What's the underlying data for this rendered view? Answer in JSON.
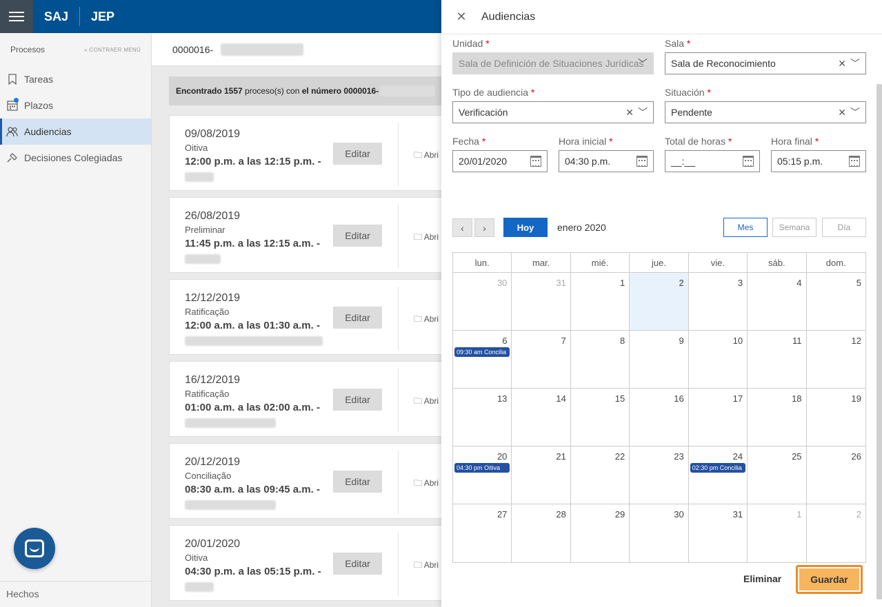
{
  "topbar": {
    "brand1": "SAJ",
    "brand2": "JEP"
  },
  "sidebar": {
    "title": "Procesos",
    "collapse": "CONTRAER MENÚ",
    "items": [
      {
        "label": "Tareas",
        "icon": "bookmark-icon"
      },
      {
        "label": "Plazos",
        "icon": "calendar-icon"
      },
      {
        "label": "Audiencias",
        "icon": "people-icon"
      },
      {
        "label": "Decisiones Colegiadas",
        "icon": "gavel-icon"
      }
    ],
    "footer": "Hechos"
  },
  "main": {
    "search_value": "0000016-",
    "found": {
      "prefix": "Encontrado 1557",
      "middle": " proceso(s) con ",
      "bold": "el número 0000016-"
    },
    "cards": [
      {
        "date": "09/08/2019",
        "type": "Oitiva",
        "time": "12:00 p.m. a las 12:15 p.m. -",
        "edit": "Editar",
        "open": "Abri"
      },
      {
        "date": "26/08/2019",
        "type": "Preliminar",
        "time": "11:45 p.m. a las 12:15 a.m. -",
        "edit": "Editar",
        "open": "Abri"
      },
      {
        "date": "12/12/2019",
        "type": "Ratificação",
        "time": "12:00 a.m. a las 01:30 a.m. -",
        "edit": "Editar",
        "open": "Abri"
      },
      {
        "date": "16/12/2019",
        "type": "Ratificação",
        "time": "01:00 a.m. a las 02:00 a.m. -",
        "edit": "Editar",
        "open": "Abri"
      },
      {
        "date": "20/12/2019",
        "type": "Conciliação",
        "time": "08:30 a.m. a las 09:45 a.m. -",
        "edit": "Editar",
        "open": "Abri"
      },
      {
        "date": "20/01/2020",
        "type": "Oitiva",
        "time": "04:30 p.m. a las 05:15 p.m. -",
        "edit": "Editar",
        "open": "Abri"
      }
    ]
  },
  "panel": {
    "title": "Audiencias",
    "unidad": {
      "label": "Unidad",
      "value": "Sala de Definición de Situaciones Jurídicas"
    },
    "sala": {
      "label": "Sala",
      "value": "Sala de Reconocimiento"
    },
    "tipo": {
      "label": "Tipo de audiencia",
      "value": "Verificación"
    },
    "situacion": {
      "label": "Situación",
      "value": "Pendente"
    },
    "fecha": {
      "label": "Fecha",
      "value": "20/01/2020"
    },
    "hora_inicial": {
      "label": "Hora inicial",
      "value": "04:30 p.m."
    },
    "total_horas": {
      "label": "Total de horas",
      "value": "__:__"
    },
    "hora_final": {
      "label": "Hora final",
      "value": "05:15 p.m."
    },
    "required_mark": "*",
    "calendar": {
      "today_btn": "Hoy",
      "month_label": "enero 2020",
      "views": [
        "Mes",
        "Semana",
        "Día"
      ],
      "weekdays": [
        "lun.",
        "mar.",
        "mié.",
        "jue.",
        "vie.",
        "sáb.",
        "dom."
      ],
      "weeks": [
        [
          {
            "d": "30",
            "o": true
          },
          {
            "d": "31",
            "o": true
          },
          {
            "d": "1"
          },
          {
            "d": "2",
            "t": true
          },
          {
            "d": "3"
          },
          {
            "d": "4"
          },
          {
            "d": "5"
          }
        ],
        [
          {
            "d": "6",
            "e": "09:30 am Concilia"
          },
          {
            "d": "7"
          },
          {
            "d": "8"
          },
          {
            "d": "9"
          },
          {
            "d": "10"
          },
          {
            "d": "11"
          },
          {
            "d": "12"
          }
        ],
        [
          {
            "d": "13"
          },
          {
            "d": "14"
          },
          {
            "d": "15"
          },
          {
            "d": "16"
          },
          {
            "d": "17"
          },
          {
            "d": "18"
          },
          {
            "d": "19"
          }
        ],
        [
          {
            "d": "20",
            "e": "04:30 pm Oitiva"
          },
          {
            "d": "21"
          },
          {
            "d": "22"
          },
          {
            "d": "23"
          },
          {
            "d": "24",
            "e": "02:30 pm Concilia"
          },
          {
            "d": "25"
          },
          {
            "d": "26"
          }
        ],
        [
          {
            "d": "27"
          },
          {
            "d": "28"
          },
          {
            "d": "29"
          },
          {
            "d": "30"
          },
          {
            "d": "31"
          },
          {
            "d": "1",
            "o": true
          },
          {
            "d": "2",
            "o": true
          }
        ]
      ]
    },
    "eliminar": "Eliminar",
    "guardar": "Guardar"
  },
  "colors": {
    "primary": "#005191",
    "accent": "#1467c5",
    "event": "#2350a0",
    "save": "#f7b55e",
    "save_border": "#f08a24"
  }
}
